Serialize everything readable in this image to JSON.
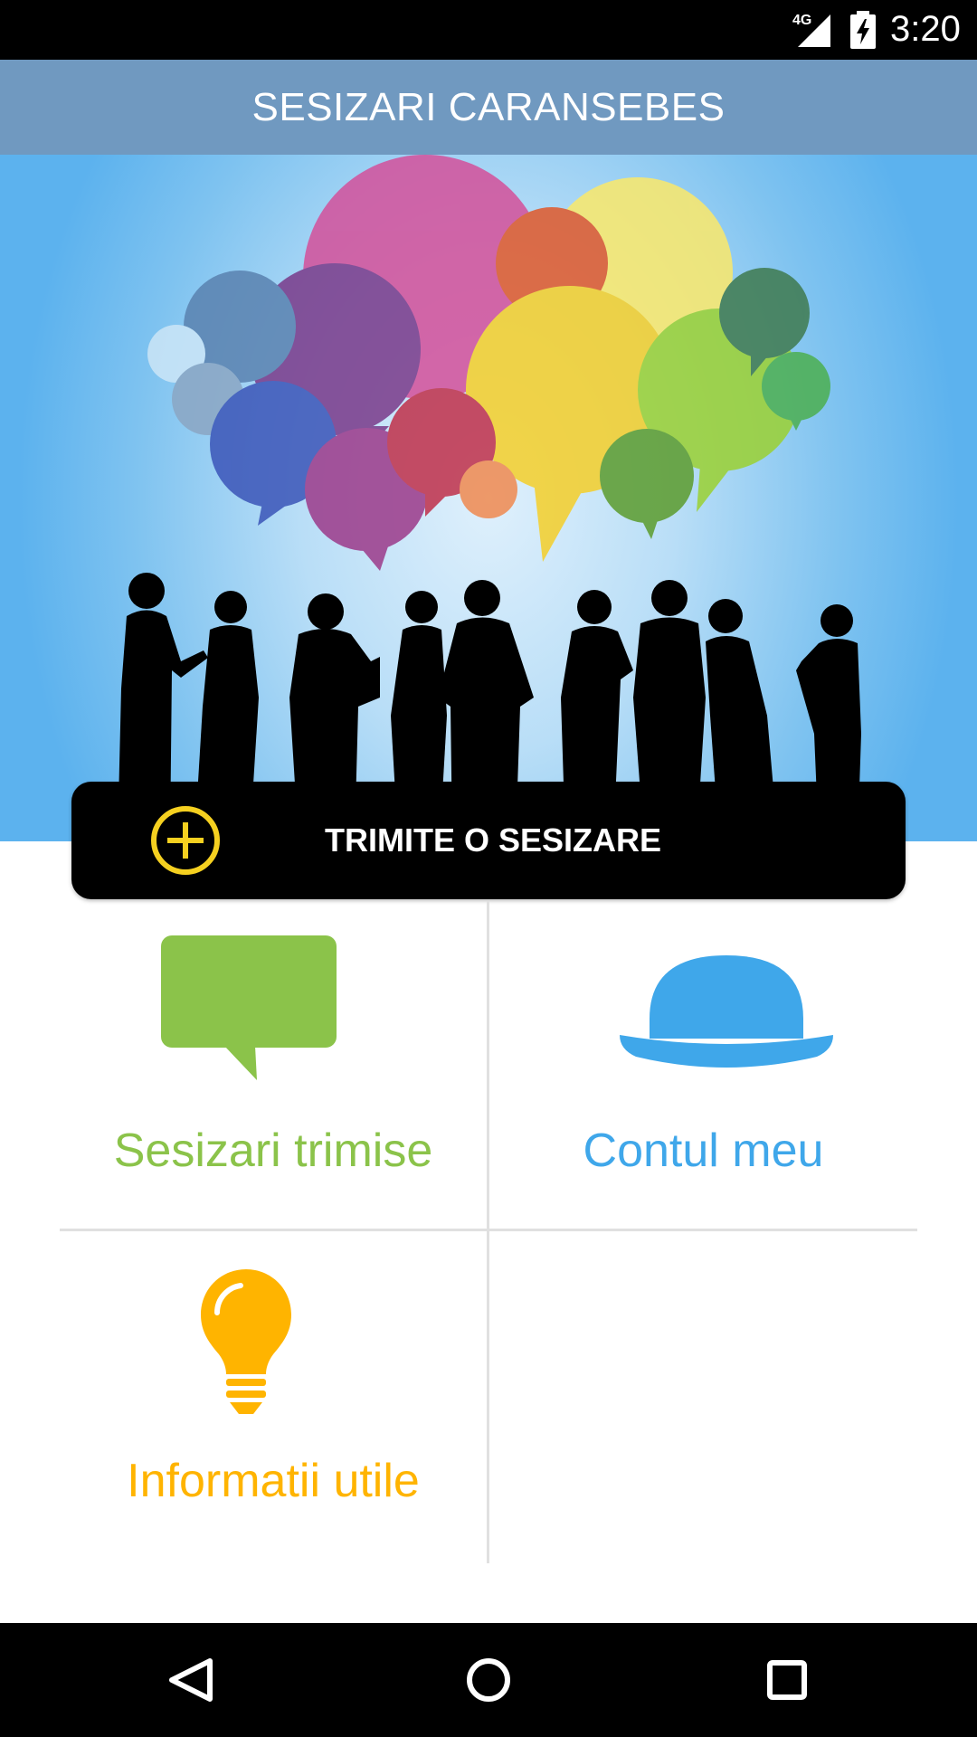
{
  "status_bar": {
    "network": "4G",
    "time": "3:20",
    "icons": [
      "signal-icon",
      "battery-charging-icon"
    ]
  },
  "app_bar": {
    "title": "SESIZARI CARANSEBES"
  },
  "hero": {
    "image": "speech-bubbles-crowd-silhouette-illustration"
  },
  "cta": {
    "label": "TRIMITE O SESIZARE",
    "icon": "plus-circle-icon",
    "icon_color": "#f5d020"
  },
  "tiles": [
    {
      "label": "Sesizari trimise",
      "icon": "speech-bubble-icon",
      "color": "#8bc34a"
    },
    {
      "label": "Contul meu",
      "icon": "bowler-hat-icon",
      "color": "#3fa7ea"
    },
    {
      "label": "Informatii utile",
      "icon": "lightbulb-icon",
      "color": "#ffb400"
    }
  ],
  "nav_bar": {
    "buttons": [
      "back-icon",
      "home-icon",
      "recents-icon"
    ]
  }
}
